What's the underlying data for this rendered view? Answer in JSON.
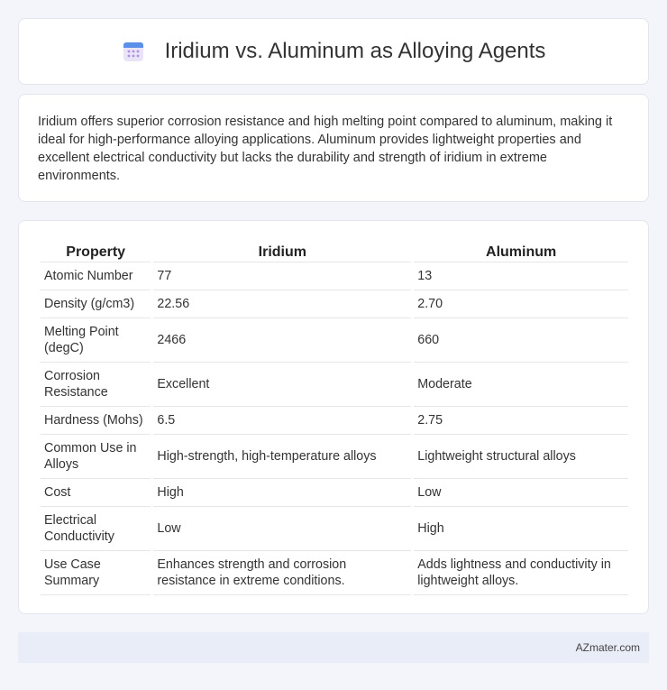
{
  "header": {
    "title": "Iridium vs. Aluminum as Alloying Agents",
    "icon": "calendar-icon"
  },
  "summary": {
    "text": "Iridium offers superior corrosion resistance and high melting point compared to aluminum, making it ideal for high-performance alloying applications. Aluminum provides lightweight properties and excellent electrical conductivity but lacks the durability and strength of iridium in extreme environments."
  },
  "table": {
    "headers": [
      "Property",
      "Iridium",
      "Aluminum"
    ],
    "rows": [
      [
        "Atomic Number",
        "77",
        "13"
      ],
      [
        "Density (g/cm3)",
        "22.56",
        "2.70"
      ],
      [
        "Melting Point (degC)",
        "2466",
        "660"
      ],
      [
        "Corrosion Resistance",
        "Excellent",
        "Moderate"
      ],
      [
        "Hardness (Mohs)",
        "6.5",
        "2.75"
      ],
      [
        "Common Use in Alloys",
        "High-strength, high-temperature alloys",
        "Lightweight structural alloys"
      ],
      [
        "Cost",
        "High",
        "Low"
      ],
      [
        "Electrical Conductivity",
        "Low",
        "High"
      ],
      [
        "Use Case Summary",
        "Enhances strength and corrosion resistance in extreme conditions.",
        "Adds lightness and conductivity in lightweight alloys."
      ]
    ]
  },
  "footer": {
    "text": "AZmater.com"
  }
}
